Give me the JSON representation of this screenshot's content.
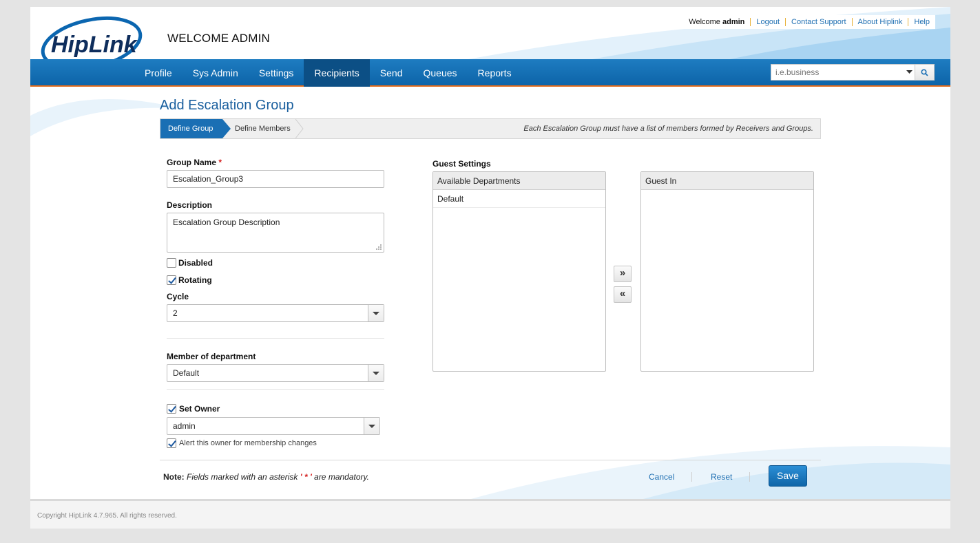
{
  "header": {
    "logo_text": "HipLink",
    "welcome_title": "WELCOME ADMIN",
    "welcome_prefix": "Welcome",
    "welcome_user": "admin",
    "links": [
      "Logout",
      "Contact Support",
      "About Hiplink",
      "Help"
    ]
  },
  "nav": {
    "items": [
      "Profile",
      "Sys Admin",
      "Settings",
      "Recipients",
      "Send",
      "Queues",
      "Reports"
    ],
    "active": "Recipients",
    "search_placeholder": "i.e.business"
  },
  "page": {
    "title": "Add Escalation Group",
    "steps": [
      "Define Group",
      "Define Members"
    ],
    "step_note": "Each Escalation Group must have a list of members formed by Receivers and Groups."
  },
  "form": {
    "group_name_label": "Group Name",
    "required_mark": "*",
    "group_name_value": "Escalation_Group3",
    "description_label": "Description",
    "description_value": "Escalation Group Description",
    "disabled_label": "Disabled",
    "disabled_checked": false,
    "rotating_label": "Rotating",
    "rotating_checked": true,
    "cycle_label": "Cycle",
    "cycle_value": "2",
    "member_dept_label": "Member of department",
    "member_dept_value": "Default",
    "set_owner_label": "Set Owner",
    "set_owner_checked": true,
    "owner_value": "admin",
    "alert_owner_label": "Alert this owner for membership changes",
    "alert_owner_checked": true
  },
  "guest": {
    "label": "Guest Settings",
    "available_header": "Available Departments",
    "available_items": [
      "Default"
    ],
    "guest_in_header": "Guest In",
    "guest_in_items": [],
    "add_symbol": "»",
    "remove_symbol": "«"
  },
  "footer": {
    "note_label": "Note:",
    "note_text": "Fields marked with an asterisk",
    "note_star": "' * '",
    "note_tail": "are mandatory.",
    "cancel": "Cancel",
    "reset": "Reset",
    "save": "Save",
    "copyright": "Copyright HipLink 4.7.965. All rights reserved."
  },
  "colors": {
    "nav_blue": "#1a6fb4",
    "active_nav": "#0c4f85",
    "accent_orange": "#e36b1a",
    "link_blue": "#1f6fb2",
    "title_blue": "#1a5f9e"
  }
}
